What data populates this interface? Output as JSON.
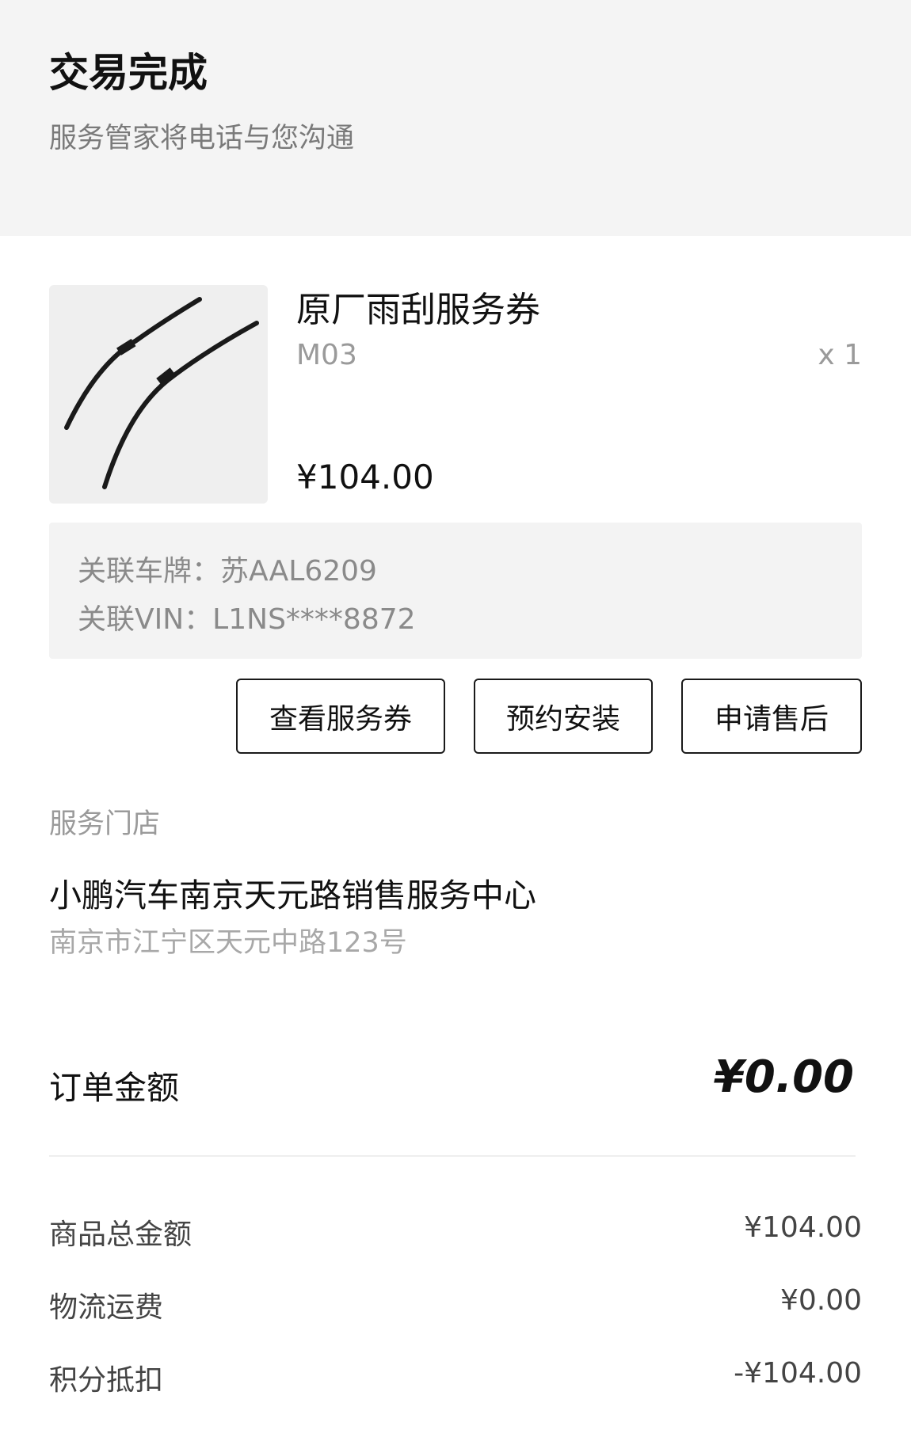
{
  "header": {
    "title": "交易完成",
    "subtitle": "服务管家将电话与您沟通"
  },
  "product": {
    "image_icon": "wiper-blades-image",
    "name": "原厂雨刮服务券",
    "variant": "M03",
    "quantity": "x 1",
    "price": "¥104.00"
  },
  "vehicle": {
    "plate": "关联车牌：苏AAL6209",
    "vin": "关联VIN：L1NS****8872"
  },
  "actions": {
    "view_voucher": "查看服务券",
    "book_install": "预约安装",
    "after_sales": "申请售后"
  },
  "store": {
    "section_label": "服务门店",
    "name": "小鹏汽车南京天元路销售服务中心",
    "address": "南京市江宁区天元中路123号"
  },
  "order": {
    "total_label": "订单金额",
    "total_value": "¥0.00",
    "rows": [
      {
        "label": "商品总金额",
        "value": "¥104.00"
      },
      {
        "label": "物流运费",
        "value": "¥0.00"
      },
      {
        "label": "积分抵扣",
        "value": "-¥104.00"
      }
    ]
  }
}
